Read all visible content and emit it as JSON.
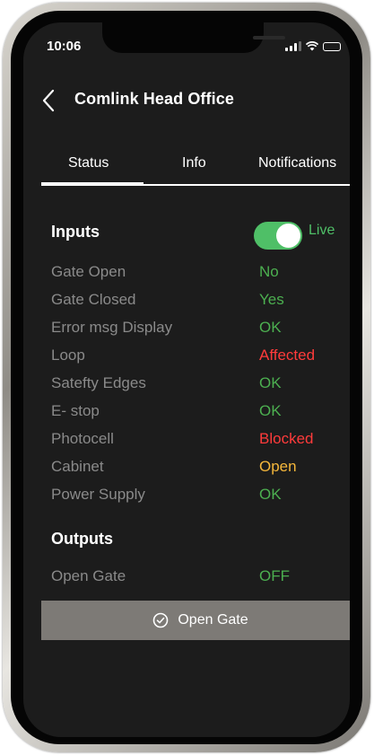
{
  "status_bar": {
    "time": "10:06"
  },
  "header": {
    "title": "Comlink Head Office"
  },
  "tabs": [
    {
      "label": "Status",
      "active": true
    },
    {
      "label": "Info",
      "active": false
    },
    {
      "label": "Notifications",
      "active": false
    }
  ],
  "inputs": {
    "title": "Inputs",
    "live_label": "Live",
    "live_enabled": true,
    "rows": [
      {
        "label": "Gate Open",
        "value": "No",
        "color": "#4caf50"
      },
      {
        "label": "Gate Closed",
        "value": "Yes",
        "color": "#4caf50"
      },
      {
        "label": "Error msg Display",
        "value": "OK",
        "color": "#4caf50"
      },
      {
        "label": "Loop",
        "value": "Affected",
        "color": "#ff3b3b"
      },
      {
        "label": "Satefty Edges",
        "value": "OK",
        "color": "#4caf50"
      },
      {
        "label": "E- stop",
        "value": "OK",
        "color": "#4caf50"
      },
      {
        "label": "Photocell",
        "value": "Blocked",
        "color": "#ff3b3b"
      },
      {
        "label": "Cabinet",
        "value": "Open",
        "color": "#f5b73b"
      },
      {
        "label": "Power Supply",
        "value": "OK",
        "color": "#4caf50"
      }
    ]
  },
  "outputs": {
    "title": "Outputs",
    "rows": [
      {
        "label": "Open Gate",
        "value": "OFF",
        "color": "#4caf50"
      }
    ]
  },
  "action_button": {
    "label": "Open Gate",
    "icon": "check-circle-icon"
  },
  "colors": {
    "accent_green": "#4fbf67",
    "error_red": "#ff3b3b",
    "warning_orange": "#f5b73b",
    "background": "#1c1c1c",
    "button_gray": "#7d7a76"
  }
}
